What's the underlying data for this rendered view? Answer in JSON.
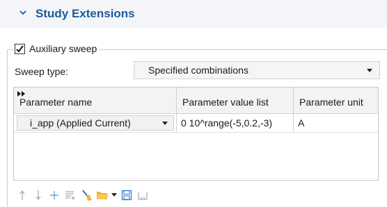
{
  "section": {
    "title": "Study Extensions"
  },
  "aux_sweep": {
    "label": "Auxiliary sweep",
    "checked": true
  },
  "sweep_type": {
    "label": "Sweep type:",
    "value": "Specified combinations"
  },
  "table": {
    "headers": [
      "Parameter name",
      "Parameter value list",
      "Parameter unit"
    ],
    "rows": [
      {
        "name": "i_app (Applied Current)",
        "values": "0 10^range(-5,0.2,-3)",
        "unit": "A"
      }
    ]
  },
  "toolbar": {
    "icons": [
      "move-up-icon",
      "move-down-icon",
      "add-icon",
      "delete-icon",
      "clear-broom-icon",
      "load-folder-icon",
      "save-icon",
      "range-icon"
    ]
  },
  "colors": {
    "accent": "#1d5a9f",
    "header_bg": "#f3f5f8",
    "toolbar_icon": "#3a7bd5"
  }
}
